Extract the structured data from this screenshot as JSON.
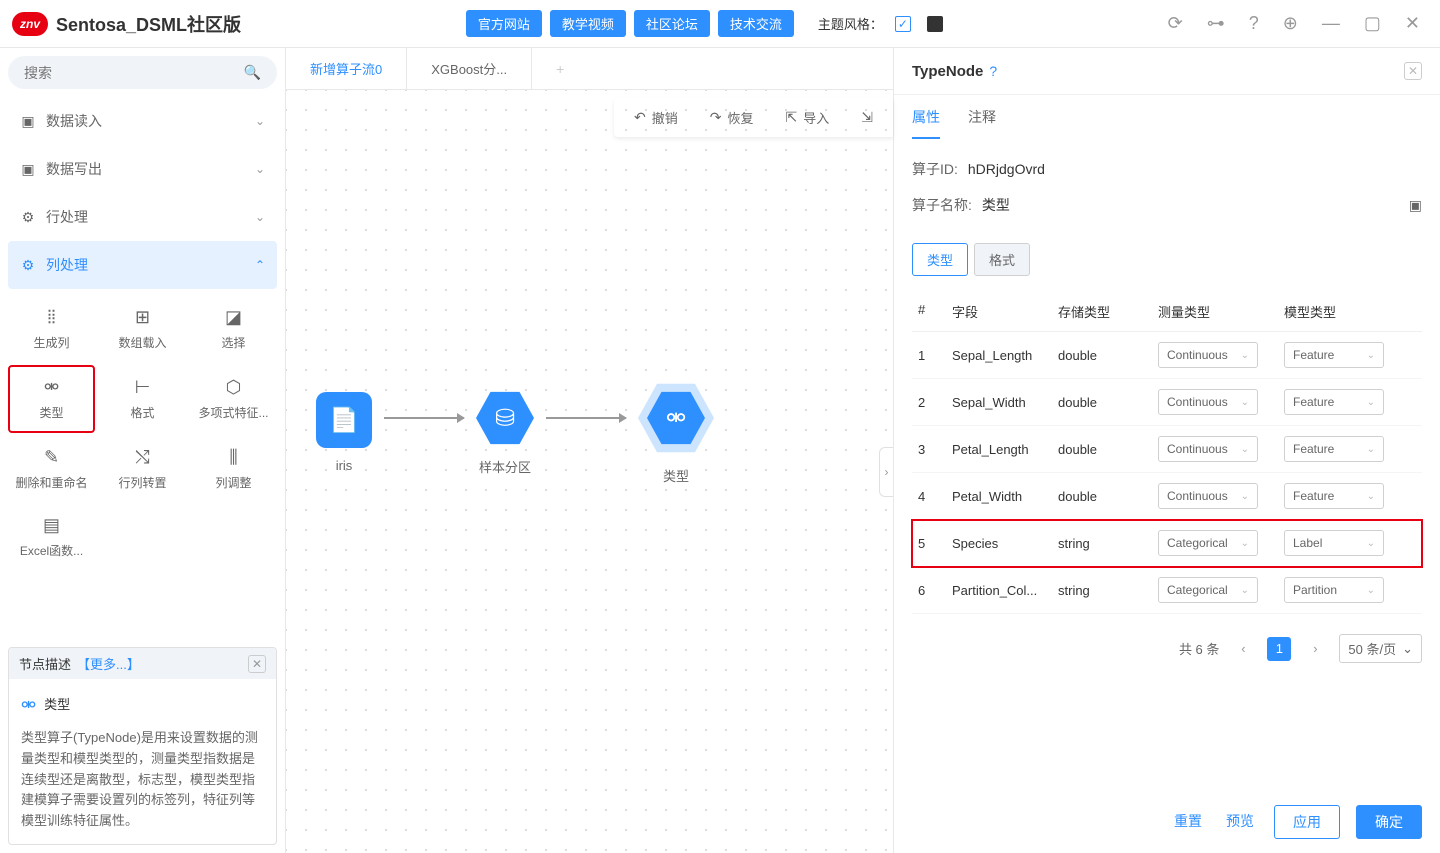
{
  "header": {
    "logo": "znv",
    "title": "Sentosa_DSML社区版",
    "buttons": [
      "官方网站",
      "教学视频",
      "社区论坛",
      "技术交流"
    ],
    "theme_label": "主题风格："
  },
  "search": {
    "placeholder": "搜索"
  },
  "categories": [
    {
      "label": "数据读入",
      "expanded": false
    },
    {
      "label": "数据写出",
      "expanded": false
    },
    {
      "label": "行处理",
      "expanded": false
    },
    {
      "label": "列处理",
      "expanded": true
    }
  ],
  "sub_items": [
    {
      "label": "生成列"
    },
    {
      "label": "数组载入"
    },
    {
      "label": "选择"
    },
    {
      "label": "类型",
      "highlighted": true
    },
    {
      "label": "格式"
    },
    {
      "label": "多项式特征..."
    },
    {
      "label": "删除和重命名"
    },
    {
      "label": "行列转置"
    },
    {
      "label": "列调整"
    },
    {
      "label": "Excel函数..."
    }
  ],
  "desc": {
    "header": "节点描述",
    "more": "【更多...】",
    "title": "类型",
    "text": "类型算子(TypeNode)是用来设置数据的测量类型和模型类型的，测量类型指数据是连续型还是离散型，标志型，模型类型指建模算子需要设置列的标签列，特征列等模型训练特征属性。"
  },
  "canvas_tabs": [
    {
      "label": "新增算子流0",
      "active": true
    },
    {
      "label": "XGBoost分...",
      "active": false
    }
  ],
  "toolbar": [
    {
      "label": "撤销"
    },
    {
      "label": "恢复"
    },
    {
      "label": "导入"
    }
  ],
  "flow_nodes": [
    {
      "label": "iris",
      "type": "rect"
    },
    {
      "label": "样本分区",
      "type": "hex"
    },
    {
      "label": "类型",
      "type": "hex",
      "selected": true
    }
  ],
  "right_panel": {
    "title": "TypeNode",
    "tabs": [
      "属性",
      "注释"
    ],
    "op_id_label": "算子ID:",
    "op_id": "hDRjdgOvrd",
    "op_name_label": "算子名称:",
    "op_name": "类型",
    "sub_tabs": [
      "类型",
      "格式"
    ],
    "columns": [
      "#",
      "字段",
      "存储类型",
      "测量类型",
      "模型类型"
    ],
    "rows": [
      {
        "idx": "1",
        "field": "Sepal_Length",
        "store": "double",
        "meas": "Continuous",
        "model": "Feature"
      },
      {
        "idx": "2",
        "field": "Sepal_Width",
        "store": "double",
        "meas": "Continuous",
        "model": "Feature"
      },
      {
        "idx": "3",
        "field": "Petal_Length",
        "store": "double",
        "meas": "Continuous",
        "model": "Feature"
      },
      {
        "idx": "4",
        "field": "Petal_Width",
        "store": "double",
        "meas": "Continuous",
        "model": "Feature"
      },
      {
        "idx": "5",
        "field": "Species",
        "store": "string",
        "meas": "Categorical",
        "model": "Label",
        "highlighted": true
      },
      {
        "idx": "6",
        "field": "Partition_Col...",
        "store": "string",
        "meas": "Categorical",
        "model": "Partition"
      }
    ],
    "pagination": {
      "total": "共 6 条",
      "page": "1",
      "size": "50 条/页"
    },
    "footer": {
      "reset": "重置",
      "preview": "预览",
      "apply": "应用",
      "confirm": "确定"
    }
  }
}
